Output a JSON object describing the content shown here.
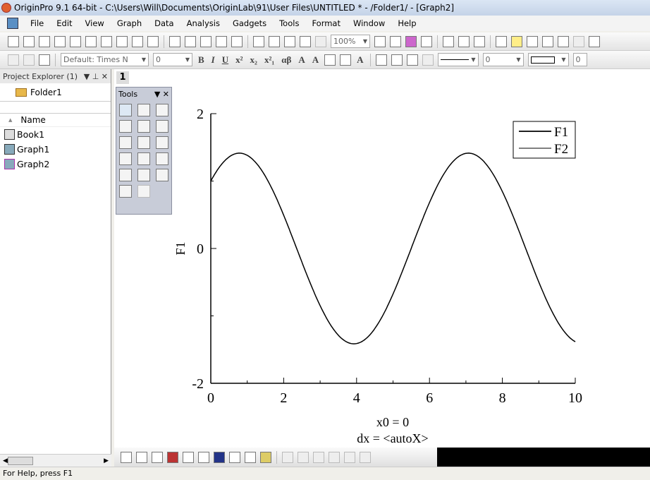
{
  "window": {
    "title": "OriginPro 9.1 64-bit - C:\\Users\\Will\\Documents\\OriginLab\\91\\User Files\\UNTITLED * - /Folder1/ - [Graph2]"
  },
  "menu": [
    "File",
    "Edit",
    "View",
    "Graph",
    "Data",
    "Analysis",
    "Gadgets",
    "Tools",
    "Format",
    "Window",
    "Help"
  ],
  "toolbar": {
    "zoom": "100%",
    "font": "Default: Times N",
    "font_size": "0",
    "line_width": "0",
    "sym_size": "0"
  },
  "project_explorer": {
    "title": "Project Explorer (1)",
    "folder": "Folder1",
    "column": "Name",
    "items": [
      {
        "label": "Book1",
        "icon": "workbook-icon"
      },
      {
        "label": "Graph1",
        "icon": "graph-icon"
      },
      {
        "label": "Graph2",
        "icon": "graph-icon"
      }
    ]
  },
  "graph": {
    "layer": "1",
    "tools_title": "Tools",
    "ylabel": "F1",
    "x0_label": "x0 = 0",
    "dx_label": "dx = <autoX>",
    "legend": [
      "F1",
      "F2"
    ]
  },
  "chart_data": {
    "type": "line",
    "function": "sin(x)+cos(x)",
    "xlim": [
      0,
      10
    ],
    "ylim": [
      -2,
      2
    ],
    "xticks": [
      "0",
      "2",
      "4",
      "6",
      "8",
      "10"
    ],
    "yticks": [
      "2",
      "0",
      "-2"
    ],
    "ylabel": "F1",
    "legend_placement": "top-right",
    "series": [
      {
        "name": "F1"
      }
    ]
  },
  "status": "For Help, press F1"
}
